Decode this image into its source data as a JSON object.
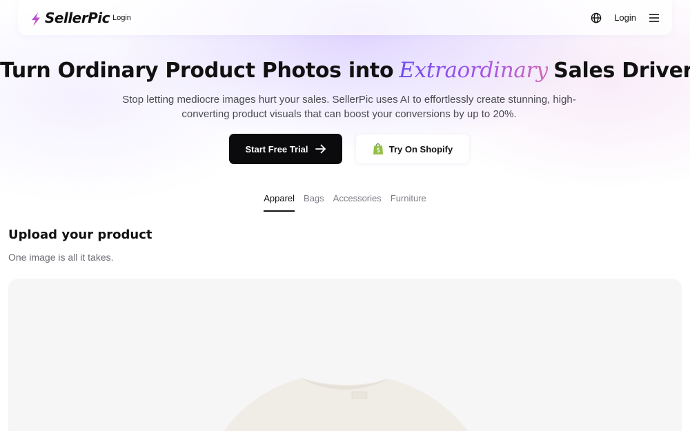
{
  "header": {
    "brand": "SellerPic",
    "brand_tagline": "Login",
    "login_label": "Login",
    "icons": {
      "language": "globe-icon",
      "menu": "hamburger-menu-icon",
      "logo": "lightning-logo-icon"
    }
  },
  "hero": {
    "title_before": "Turn Ordinary Product Photos into",
    "title_accent": "Extraordinary",
    "title_after": "Sales Drivers",
    "subtitle": "Stop letting mediocre images hurt your sales. SellerPic uses AI to effortlessly create stunning, high-converting product visuals that can boost your conversions by up to 20%.",
    "cta_primary": "Start Free Trial",
    "cta_secondary": "Try On Shopify"
  },
  "tabs": [
    {
      "label": "Apparel",
      "active": true
    },
    {
      "label": "Bags",
      "active": false
    },
    {
      "label": "Accessories",
      "active": false
    },
    {
      "label": "Furniture",
      "active": false
    }
  ],
  "upload": {
    "title": "Upload your product",
    "subtitle": "One image is all it takes."
  },
  "colors": {
    "accent_gradient_start": "#6d4cf0",
    "accent_gradient_end": "#d269b8",
    "primary_button": "#0b0b0d",
    "shopify_green": "#95bf47"
  }
}
